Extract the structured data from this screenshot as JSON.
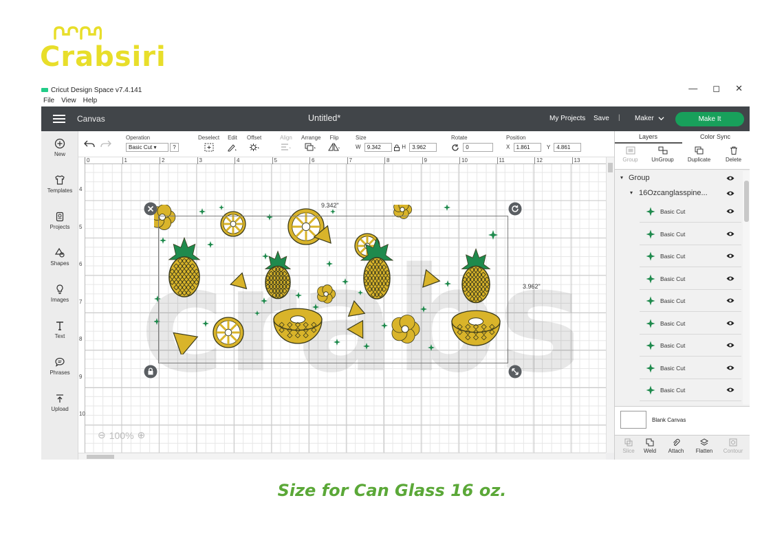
{
  "brand": {
    "name": "Crabsiri",
    "color": "#e8de2a"
  },
  "window": {
    "title": "Cricut Design Space  v7.4.141",
    "controls": [
      "—",
      "◻",
      "✕"
    ]
  },
  "menu": [
    "File",
    "View",
    "Help"
  ],
  "topbar": {
    "canvas_label": "Canvas",
    "doc_title": "Untitled*",
    "my_projects": "My Projects",
    "save": "Save",
    "sep": "|",
    "machine": "Maker",
    "make_it": "Make It"
  },
  "leftbar": [
    {
      "label": "New",
      "icon": "plus-circle-icon"
    },
    {
      "label": "Templates",
      "icon": "shirt-icon"
    },
    {
      "label": "Projects",
      "icon": "projects-icon"
    },
    {
      "label": "Shapes",
      "icon": "shapes-icon"
    },
    {
      "label": "Images",
      "icon": "bulb-icon"
    },
    {
      "label": "Text",
      "icon": "text-icon"
    },
    {
      "label": "Phrases",
      "icon": "speech-bubble-icon"
    },
    {
      "label": "Upload",
      "icon": "upload-icon"
    }
  ],
  "toolbar": {
    "operation_label": "Operation",
    "operation_value": "Basic Cut",
    "help": "?",
    "deselect": "Deselect",
    "edit": "Edit",
    "offset": "Offset",
    "align": "Align",
    "arrange": "Arrange",
    "flip": "Flip",
    "size_label": "Size",
    "w_label": "W",
    "w_value": "9.342",
    "h_label": "H",
    "h_value": "3.962",
    "rotate_label": "Rotate",
    "rotate_value": "0",
    "position_label": "Position",
    "x_label": "X",
    "x_value": "1.861",
    "y_label": "Y",
    "y_value": "4.861"
  },
  "canvas": {
    "ruler_top": [
      "0",
      "1",
      "2",
      "3",
      "4",
      "5",
      "6",
      "7",
      "8",
      "9",
      "10",
      "11",
      "12",
      "13"
    ],
    "ruler_left": [
      "4",
      "5",
      "6",
      "7",
      "8",
      "9",
      "10"
    ],
    "width_dim": "9.342\"",
    "height_dim": "3.962\"",
    "zoom_minus": "⊖",
    "zoom": "100%",
    "zoom_plus": "⊕",
    "watermark": "crabsiri",
    "colors": {
      "gold": "#d9b42a",
      "green": "#1f8a4d",
      "outline": "#3b3b1c"
    }
  },
  "panel": {
    "tabs": [
      "Layers",
      "Color Sync"
    ],
    "tools": [
      {
        "label": "Group",
        "enabled": false
      },
      {
        "label": "UnGroup",
        "enabled": true
      },
      {
        "label": "Duplicate",
        "enabled": true
      },
      {
        "label": "Delete",
        "enabled": true
      }
    ],
    "group": "Group",
    "subgroup": "16Ozcanglasspine...",
    "layers": [
      "Basic Cut",
      "Basic Cut",
      "Basic Cut",
      "Basic Cut",
      "Basic Cut",
      "Basic Cut",
      "Basic Cut",
      "Basic Cut",
      "Basic Cut"
    ],
    "blank_canvas": "Blank Canvas",
    "bottom": [
      {
        "label": "Slice",
        "enabled": false
      },
      {
        "label": "Weld",
        "enabled": true
      },
      {
        "label": "Attach",
        "enabled": true
      },
      {
        "label": "Flatten",
        "enabled": true
      },
      {
        "label": "Contour",
        "enabled": false
      }
    ]
  },
  "caption": "Size for Can Glass 16 oz."
}
